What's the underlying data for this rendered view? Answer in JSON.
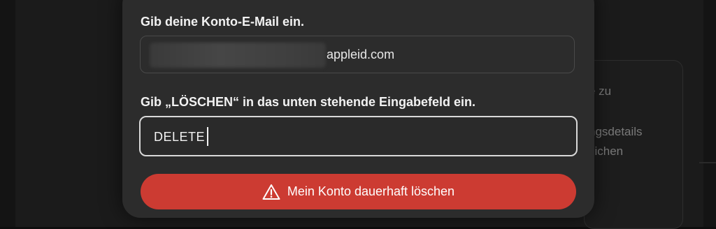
{
  "background": {
    "card_lines": [
      "e zu",
      "ngsdetails",
      "tlichen"
    ]
  },
  "modal": {
    "email_label": "Gib deine Konto-E-Mail ein.",
    "email_field": {
      "visible_suffix": "appleid.com"
    },
    "delete_label": "Gib „LÖSCHEN“ in das unten stehende Eingabefeld ein.",
    "delete_field": {
      "value": "DELETE"
    },
    "delete_button": {
      "label": "Mein Konto dauerhaft löschen",
      "icon": "warning-triangle-icon",
      "color": "#cc3b32"
    }
  }
}
